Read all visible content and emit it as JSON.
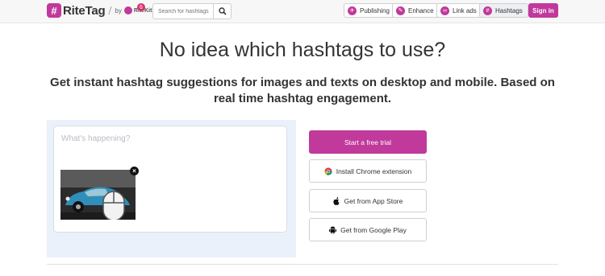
{
  "header": {
    "logo_text": "RiteTag",
    "sep": "/",
    "by": "by",
    "ritekit": "RiteKit",
    "badge_count": "6",
    "search_placeholder": "Search for hashtags",
    "nav": [
      {
        "label": "Publishing",
        "icon": "publishing-icon"
      },
      {
        "label": "Enhance",
        "icon": "enhance-icon"
      },
      {
        "label": "Link ads",
        "icon": "link-ads-icon"
      },
      {
        "label": "Hashtags",
        "icon": "hashtags-icon",
        "active": true
      }
    ],
    "signin": "Sign in"
  },
  "hero": {
    "title": "No idea which hashtags to use?",
    "subtitle": "Get instant hashtag suggestions for images and texts on desktop and mobile. Based on real time hashtag engagement."
  },
  "composer": {
    "placeholder": "What's happening?"
  },
  "cta": {
    "trial": "Start a free trial",
    "chrome": "Install Chrome extension",
    "appstore": "Get from App Store",
    "googleplay": "Get from Google Play"
  },
  "colors": {
    "brand": "#c0399b",
    "panel": "#eaf1fb"
  }
}
